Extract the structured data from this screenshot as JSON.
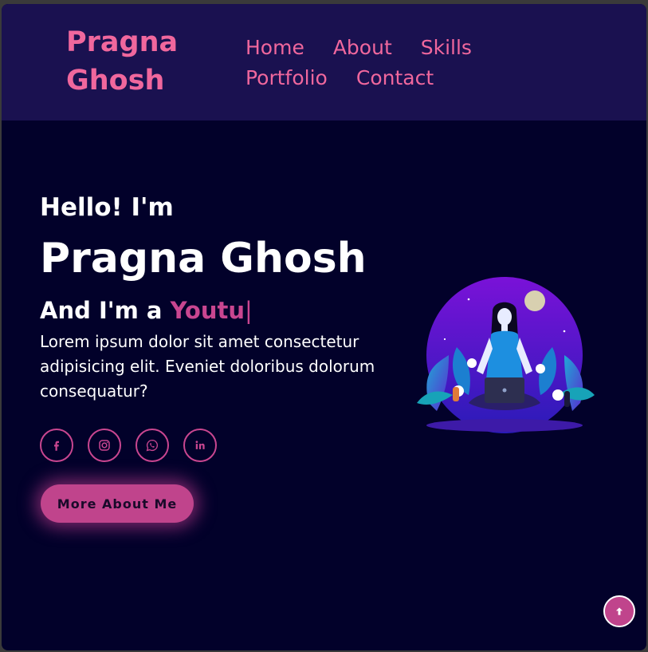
{
  "header": {
    "brand_line1": "Pragna",
    "brand_line2": "Ghosh",
    "nav": [
      "Home",
      "About",
      "Skills",
      "Portfolio",
      "Contact"
    ]
  },
  "hero": {
    "greeting": "Hello! I'm",
    "name": "Pragna Ghosh",
    "role_prefix": "And I'm a ",
    "role_typed": "Youtu",
    "cursor": "|",
    "description": "Lorem ipsum dolor sit amet consectetur adipisicing elit. Eveniet doloribus dolorum consequatur?",
    "socials": [
      "facebook-icon",
      "instagram-icon",
      "whatsapp-icon",
      "linkedin-icon"
    ],
    "button_label": "More About Me"
  },
  "colors": {
    "accent": "#f0679d",
    "accent_dark": "#c94690",
    "header_bg": "#1a1150",
    "page_bg": "#02012a"
  },
  "scroll_top_icon": "arrow-up-icon"
}
